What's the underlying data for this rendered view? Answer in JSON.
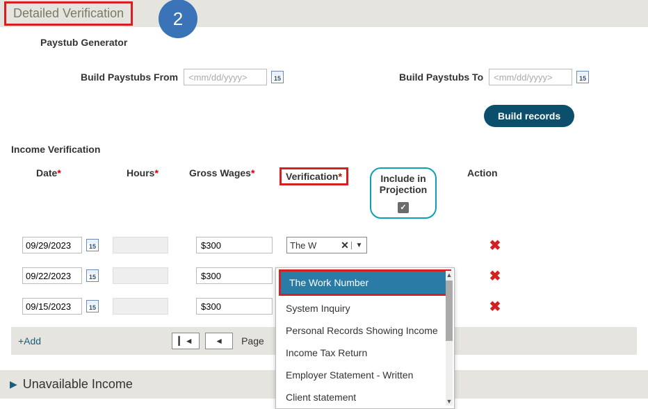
{
  "header": {
    "title": "Detailed Verification"
  },
  "step": "2",
  "paystub_generator": {
    "label": "Paystub Generator",
    "from_label": "Build Paystubs From",
    "to_label": "Build Paystubs To",
    "placeholder": "<mm/dd/yyyy>",
    "button": "Build records",
    "cal_text": "15"
  },
  "income_verification": {
    "title": "Income Verification",
    "columns": {
      "date": "Date",
      "hours": "Hours",
      "gross_wages": "Gross Wages",
      "verification": "Verification",
      "include": "Include in Projection",
      "action": "Action"
    },
    "rows": [
      {
        "date": "09/29/2023",
        "wages": "$300",
        "verification_display": "The W"
      },
      {
        "date": "09/22/2023",
        "wages": "$300"
      },
      {
        "date": "09/15/2023",
        "wages": "$300"
      }
    ],
    "footer": {
      "add": "+Add",
      "page": "Page"
    }
  },
  "dropdown": {
    "options": [
      "The Work Number",
      "System Inquiry",
      "Personal Records Showing Income",
      "Income Tax Return",
      "Employer Statement - Written",
      "Client statement"
    ],
    "selected_index": 0
  },
  "accordion": {
    "label": "Unavailable Income"
  }
}
